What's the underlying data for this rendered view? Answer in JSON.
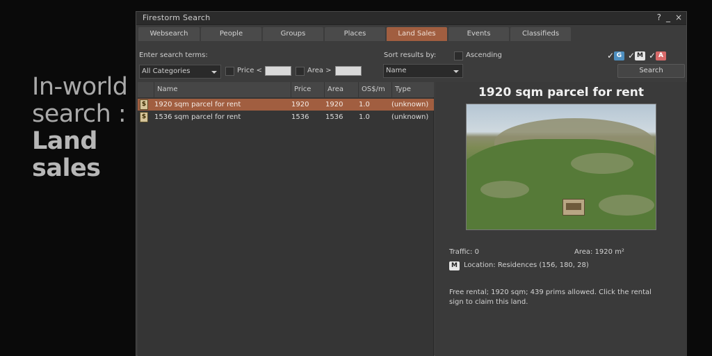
{
  "caption": {
    "line1": "In-world",
    "line2": "search :",
    "line3": "Land",
    "line4": "sales"
  },
  "window": {
    "title": "Firestorm Search",
    "help": "?",
    "minimize": "_",
    "close": "×"
  },
  "tabs": [
    "Websearch",
    "People",
    "Groups",
    "Places",
    "Land Sales",
    "Events",
    "Classifieds"
  ],
  "active_tab": "Land Sales",
  "search": {
    "terms_label": "Enter search terms:",
    "category_value": "All Categories",
    "price_label": "Price <",
    "price_value": "",
    "area_label": "Area >",
    "area_value": "",
    "sort_label": "Sort results by:",
    "ascending_label": "Ascending",
    "sort_value": "Name",
    "search_button": "Search",
    "maturity": {
      "g": "G",
      "m": "M",
      "a": "A",
      "checked": [
        true,
        true,
        true
      ]
    }
  },
  "table": {
    "columns": [
      "Name",
      "Price",
      "Area",
      "OS$/m",
      "Type"
    ],
    "rows": [
      {
        "icon": "$",
        "name": "1920 sqm parcel for rent",
        "price": "1920",
        "area": "1920",
        "rate": "1.0",
        "type": "(unknown)",
        "selected": true
      },
      {
        "icon": "$",
        "name": "1536 sqm parcel for rent",
        "price": "1536",
        "area": "1536",
        "rate": "1.0",
        "type": "(unknown)",
        "selected": false
      }
    ]
  },
  "detail": {
    "title": "1920 sqm parcel for rent",
    "traffic": "Traffic: 0",
    "area": "Area: 1920 m²",
    "maturity": "M",
    "location": "Location: Residences (156, 180, 28)",
    "description": "Free rental; 1920 sqm; 439 prims allowed. Click the rental sign to claim this land."
  },
  "colors": {
    "accent": "#a15e40",
    "background": "#3c3c3c",
    "page": "#0a0a0a"
  }
}
